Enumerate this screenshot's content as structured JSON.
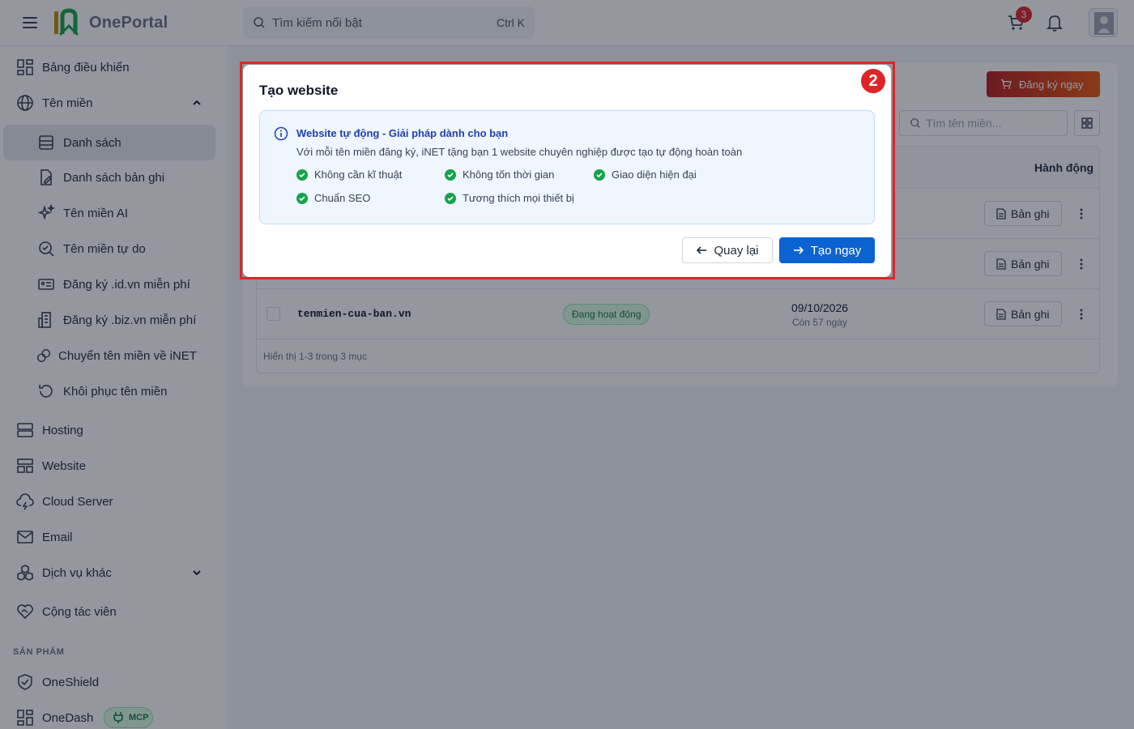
{
  "header": {
    "brand": "OnePortal",
    "search_placeholder": "Tìm kiếm nổi bật",
    "search_shortcut": "Ctrl K",
    "cart_count": "3"
  },
  "sidebar": {
    "items": [
      {
        "label": "Bảng điều khiển"
      },
      {
        "label": "Tên miền"
      },
      {
        "label": "Danh sách"
      },
      {
        "label": "Danh sách bản ghi"
      },
      {
        "label": "Tên miền AI"
      },
      {
        "label": "Tên miền tự do"
      },
      {
        "label": "Đăng ký .id.vn miễn phí"
      },
      {
        "label": "Đăng ký .biz.vn miễn phí"
      },
      {
        "label": "Chuyển tên miền về iNET"
      },
      {
        "label": "Khôi phục tên miền"
      },
      {
        "label": "Hosting"
      },
      {
        "label": "Website"
      },
      {
        "label": "Cloud Server"
      },
      {
        "label": "Email"
      },
      {
        "label": "Dịch vụ khác"
      },
      {
        "label": "Cộng tác viên"
      }
    ],
    "section_products": "SẢN PHẨM",
    "products": [
      {
        "label": "OneShield"
      },
      {
        "label": "OneDash",
        "badge": "MCP"
      }
    ]
  },
  "main": {
    "register_button": "Đăng ký ngay",
    "domain_search_placeholder": "Tìm tên miền...",
    "table": {
      "action_header": "Hành động",
      "record_button": "Bản ghi",
      "last_row": {
        "domain": "tenmien-cua-ban.vn",
        "status": "Đang hoạt động",
        "expiry_date": "09/10/2026",
        "remaining": "Còn 57 ngày"
      },
      "footer": "Hiển thị 1-3 trong 3 mục"
    }
  },
  "modal": {
    "step_number": "2",
    "title": "Tạo website",
    "info_title": "Website tự động - Giải pháp dành cho bạn",
    "info_desc": "Với mỗi tên miền đăng ký, iNET tặng bạn 1 website chuyên nghiệp được tạo tự động hoàn toàn",
    "features": [
      "Không cần kĩ thuật",
      "Không tốn thời gian",
      "Giao diện hiện đại",
      "Chuẩn SEO",
      "Tương thích mọi thiết bị"
    ],
    "back_button": "Quay lại",
    "create_button": "Tạo ngay"
  },
  "colors": {
    "primary": "#0b63d1",
    "highlight": "#dc2626",
    "success": "#16a34a",
    "info_bg": "#eff6ff"
  }
}
